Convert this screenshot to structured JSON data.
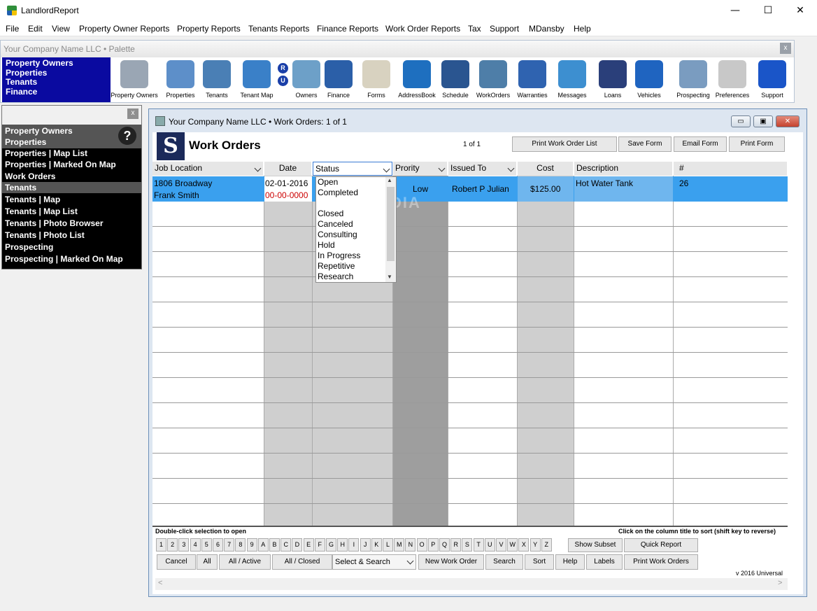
{
  "window": {
    "title": "LandlordReport",
    "minimize": "—",
    "maximize": "☐",
    "close": "✕"
  },
  "menu": [
    "File",
    "Edit",
    "View",
    "Property Owner Reports",
    "Property Reports",
    "Tenants Reports",
    "Finance Reports",
    "Work Order Reports",
    "Tax",
    "Support",
    "MDansby",
    "Help"
  ],
  "palette": {
    "title": "Your Company Name LLC  •  Palette",
    "close": "x",
    "nav": [
      "Property Owners",
      "Properties",
      "Tenants",
      "Finance"
    ],
    "ru_letters": [
      "R",
      "U"
    ],
    "tools": [
      {
        "label": "Property Owners",
        "icon": "building-icon",
        "color": "#9aa6b4"
      },
      {
        "label": "Properties",
        "icon": "house-icon",
        "color": "#5d8fc9"
      },
      {
        "label": "Tenants",
        "icon": "people-icon",
        "color": "#4a7fb5"
      },
      {
        "label": "Tenant Map",
        "icon": "magnifier-icon",
        "color": "#3a80c8"
      },
      {
        "label": "Owners",
        "icon": "owners-building-icon",
        "color": "#6da0c8"
      },
      {
        "label": "Finance",
        "icon": "bank-icon",
        "color": "#2b5fa8"
      },
      {
        "label": "Forms",
        "icon": "forms-icon",
        "color": "#d8d2c0"
      },
      {
        "label": "AddressBook",
        "icon": "addressbook-icon",
        "color": "#1e6fbf"
      },
      {
        "label": "Schedule",
        "icon": "schedule-icon",
        "color": "#2a5590"
      },
      {
        "label": "WorkOrders",
        "icon": "tools-icon",
        "color": "#4e7ea8"
      },
      {
        "label": "Warranties",
        "icon": "warranty-badge-icon",
        "color": "#2f63b0"
      },
      {
        "label": "Messages",
        "icon": "telephone-icon",
        "color": "#3d8fd0"
      },
      {
        "label": "Loans",
        "icon": "hourglass-icon",
        "color": "#2a3f7a"
      },
      {
        "label": "Vehicles",
        "icon": "car-icon",
        "color": "#1f64c0"
      },
      {
        "label": "Prospecting",
        "icon": "towers-icon",
        "color": "#7a9cc0"
      },
      {
        "label": "Preferences",
        "icon": "wrench-screwdriver-icon",
        "color": "#c8c8c8"
      },
      {
        "label": "Support",
        "icon": "help-icon",
        "color": "#1a55c8"
      }
    ]
  },
  "sidenav": {
    "close": "x",
    "help": "?",
    "items": [
      "Property Owners",
      "Properties",
      "Properties | Map List",
      "Properties | Marked On Map",
      "Work Orders",
      "Tenants",
      "Tenants | Map",
      "Tenants | Map List",
      "Tenants | Photo Browser",
      "Tenants | Photo List",
      "Prospecting",
      "Prospecting | Marked On Map"
    ]
  },
  "mdi": {
    "title": "Your Company Name LLC  •  Work Orders: 1 of 1",
    "min": "▭",
    "restore": "▣",
    "close": "✕"
  },
  "form": {
    "logo_letter": "S",
    "title": "Work Orders",
    "page": "1  of  1",
    "buttons": [
      "Print Work Order List",
      "Save Form",
      "Email Form",
      "Print Form"
    ],
    "columns": [
      "Job Location",
      "Date",
      "Status",
      "Prority",
      "Issued To",
      "Cost",
      "Description",
      "#"
    ],
    "row": {
      "location1": "1806 Broadway",
      "location2": "Frank Smith",
      "date1": "02-01-2016",
      "date2": "00-00-0000",
      "priority": "Low",
      "issued_to": "Robert P Julian",
      "cost": "$125.00",
      "description": "Hot Water Tank",
      "number": "26"
    },
    "status_options": [
      "Open",
      "Completed",
      "",
      "Closed",
      "Canceled",
      "Consulting",
      "Hold",
      "In Progress",
      "Repetitive",
      "Research"
    ],
    "watermark": "SOFTPEDIA",
    "status_left": "Double-click selection to open",
    "status_right": "Click on the column title to sort (shift key to reverse)",
    "keys": [
      "1",
      "2",
      "3",
      "4",
      "5",
      "6",
      "7",
      "8",
      "9",
      "A",
      "B",
      "C",
      "D",
      "E",
      "F",
      "G",
      "H",
      "I",
      "J",
      "K",
      "L",
      "M",
      "N",
      "O",
      "P",
      "Q",
      "R",
      "S",
      "T",
      "U",
      "V",
      "W",
      "X",
      "Y",
      "Z"
    ],
    "show_subset": "Show Subset",
    "quick_report": "Quick Report",
    "bottom_buttons": [
      "Cancel",
      "All",
      "All / Active",
      "All / Closed",
      "Select & Search",
      "New Work Order",
      "Search",
      "Sort",
      "Help",
      "Labels",
      "Print Work Orders"
    ],
    "version": "v 2016 Universal",
    "scroll_left": "<",
    "scroll_right": ">"
  },
  "colors": {
    "palette_nav": "#0a0aa0",
    "selection": "#3aa0ee",
    "date_red": "#cc0000",
    "priority_col": "#9e9e9e",
    "gray_col": "#cfcfcf"
  }
}
